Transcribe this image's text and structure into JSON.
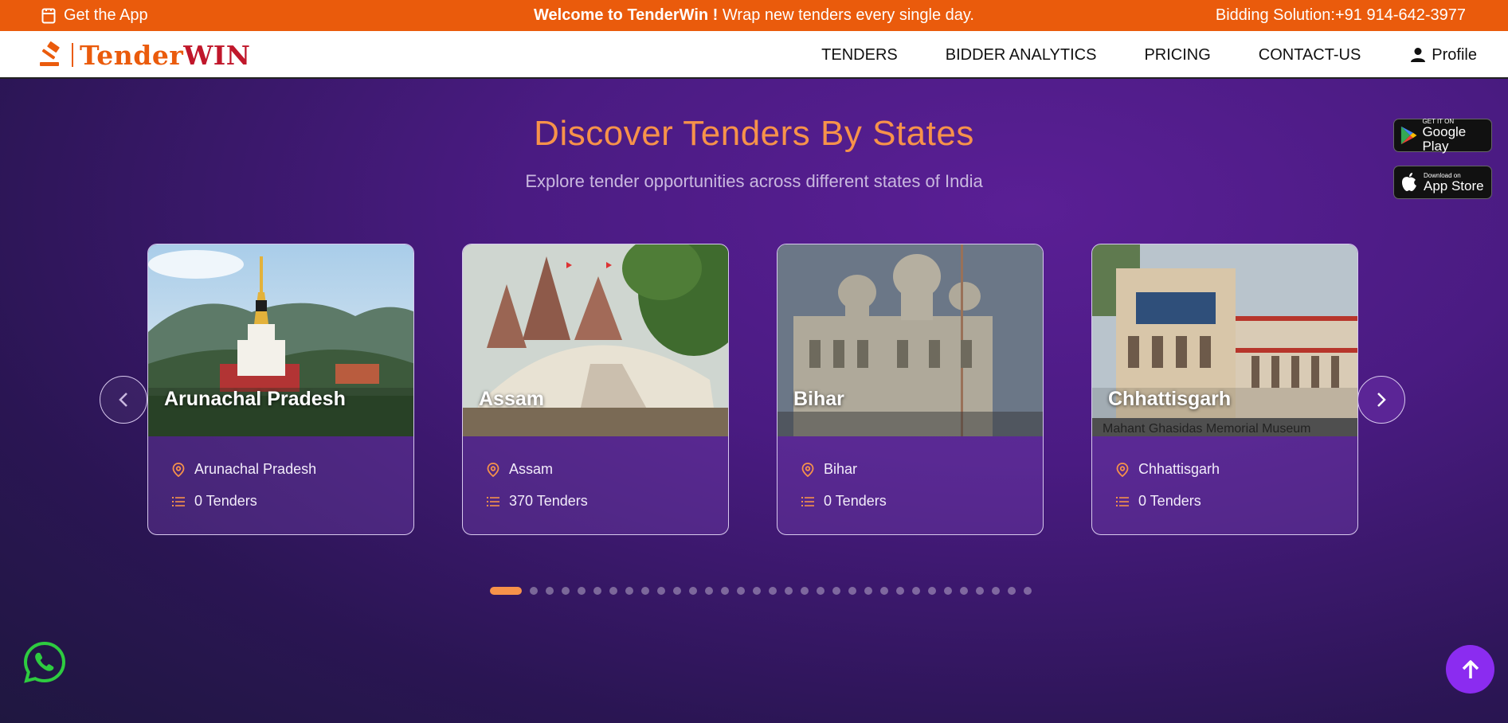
{
  "topbar": {
    "get_app": "Get the App",
    "welcome_bold": "Welcome to TenderWin !",
    "welcome_rest": " Wrap new tenders every single day.",
    "phone": "Bidding Solution:+91 914-642-3977"
  },
  "nav": {
    "logo_part1": "Tender",
    "logo_part2": "WIN",
    "items": [
      "TENDERS",
      "BIDDER ANALYTICS",
      "PRICING",
      "CONTACT-US"
    ],
    "profile": "Profile"
  },
  "hero": {
    "title": "Discover Tenders By States",
    "subtitle": "Explore tender opportunities across different states of India"
  },
  "stores": {
    "google_small": "GET IT ON",
    "google_big": "Google Play",
    "apple_small": "Download on",
    "apple_big": "App Store"
  },
  "cards": [
    {
      "title": "Arunachal Pradesh",
      "location": "Arunachal Pradesh",
      "tenders": "0 Tenders"
    },
    {
      "title": "Assam",
      "location": "Assam",
      "tenders": "370 Tenders"
    },
    {
      "title": "Bihar",
      "location": "Bihar",
      "tenders": "0 Tenders"
    },
    {
      "title": "Chhattisgarh",
      "location": "Chhattisgarh",
      "tenders": "0 Tenders",
      "image_caption": "Mahant Ghasidas Memorial Museum"
    }
  ],
  "carousel": {
    "dot_count": 33,
    "active_index": 0
  },
  "colors": {
    "accent": "#ea5b0c",
    "title": "#f7924a",
    "brand_red": "#c0172b",
    "scroll_top": "#8b2cf0"
  },
  "icons": {
    "whatsapp": "whatsapp-icon",
    "scroll_top": "arrow-up-icon",
    "location": "map-pin-icon",
    "list": "list-icon"
  }
}
